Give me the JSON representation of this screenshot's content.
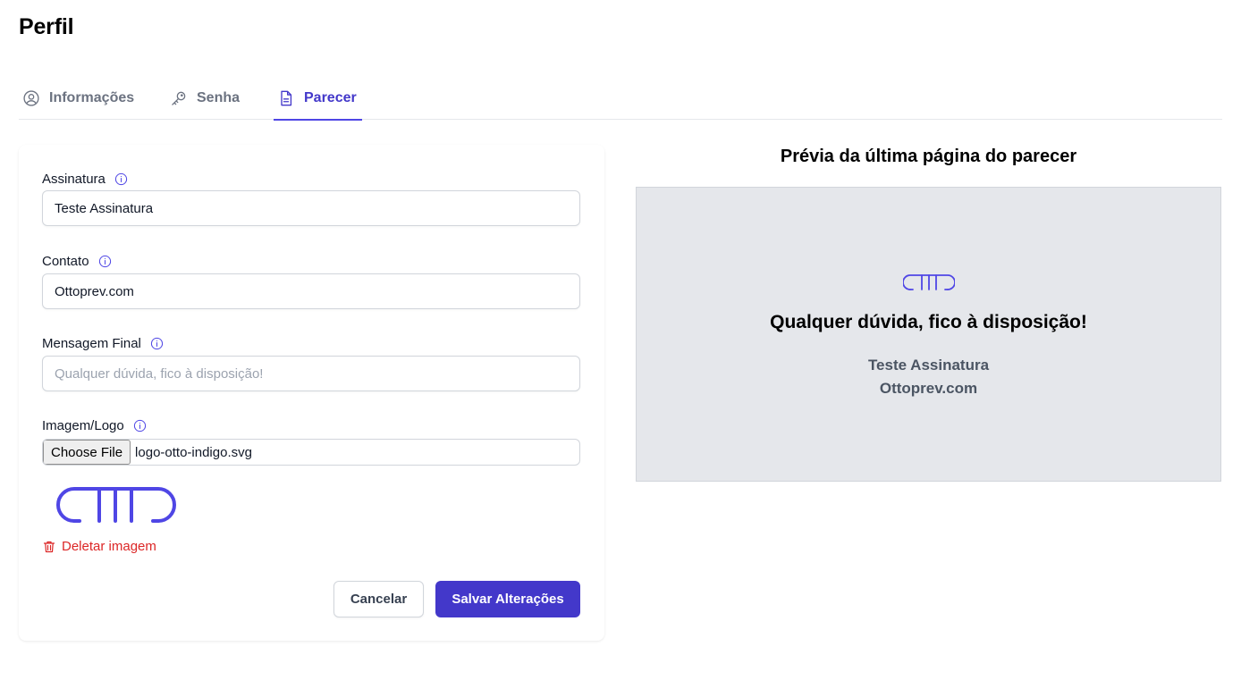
{
  "page": {
    "title": "Perfil"
  },
  "tabs": [
    {
      "label": "Informações",
      "icon": "user-circle-icon",
      "active": false
    },
    {
      "label": "Senha",
      "icon": "key-icon",
      "active": false
    },
    {
      "label": "Parecer",
      "icon": "document-icon",
      "active": true
    }
  ],
  "form": {
    "signature": {
      "label": "Assinatura",
      "value": "Teste Assinatura"
    },
    "contact": {
      "label": "Contato",
      "value": "Ottoprev.com"
    },
    "final_message": {
      "label": "Mensagem Final",
      "value": "",
      "placeholder": "Qualquer dúvida, fico à disposição!"
    },
    "image": {
      "label": "Imagem/Logo",
      "button_label": "Choose File",
      "file_name": "logo-otto-indigo.svg"
    },
    "delete_label": "Deletar imagem",
    "cancel_label": "Cancelar",
    "save_label": "Salvar Alterações"
  },
  "preview": {
    "title": "Prévia da última página do parecer",
    "message": "Qualquer dúvida, fico à disposição!",
    "signature": "Teste Assinatura",
    "contact": "Ottoprev.com"
  },
  "colors": {
    "accent": "#4338ca",
    "logo": "#4f46e5",
    "danger": "#dc2626",
    "preview_bg": "#e5e7eb"
  }
}
